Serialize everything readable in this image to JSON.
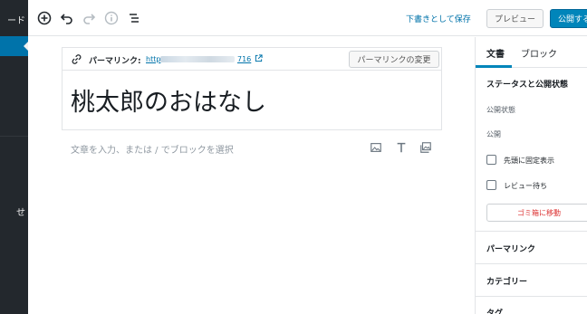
{
  "admin_menu": {
    "top_item": "ード",
    "sub_item": "せ"
  },
  "toolbar": {
    "save_draft": "下書きとして保存",
    "preview": "プレビュー",
    "publish": "公開する"
  },
  "permalink": {
    "label": "パーマリンク:",
    "url_start": "http",
    "url_end": "716",
    "change_button": "パーマリンクの変更"
  },
  "post": {
    "title": "桃太郎のおはなし",
    "block_placeholder": "文章を入力、または / でブロックを選択"
  },
  "settings": {
    "tabs": [
      "文書",
      "ブロック"
    ],
    "status_heading": "ステータスと公開状態",
    "visibility_label": "公開状態",
    "publish_label": "公開",
    "sticky_label": "先頭に固定表示",
    "pending_label": "レビュー待ち",
    "trash_button": "ゴミ箱に移動",
    "permalink_heading": "パーマリンク",
    "categories_heading": "カテゴリー",
    "tags_heading": "タグ"
  },
  "colors": {
    "admin_bg": "#23282d",
    "accent": "#0073aa",
    "publish": "#0085ba",
    "danger": "#dc3232"
  }
}
